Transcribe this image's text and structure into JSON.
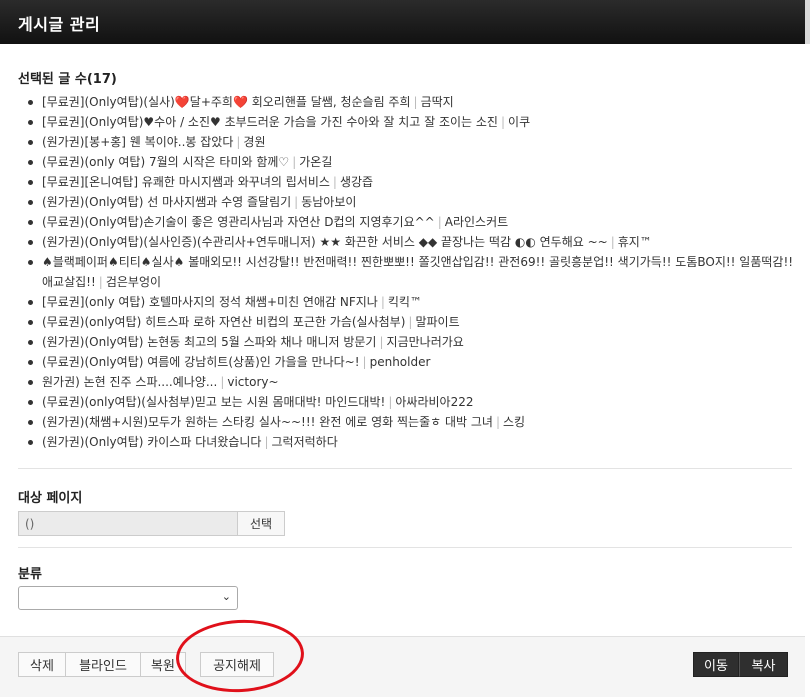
{
  "dialog": {
    "title": "게시글 관리"
  },
  "selected": {
    "heading": "선택된 글 수(17)",
    "posts": [
      {
        "title": "[무료권](Only여탑)(실사)❤️달+주희❤️ 회오리핸플 달쌤, 청순슬림 주희",
        "author": "금딱지"
      },
      {
        "title": "[무료권](Only여탑)♥수아 / 소진♥ 초부드러운 가슴을 가진 수아와 잘 치고 잘 조이는 소진",
        "author": "이쿠"
      },
      {
        "title": "(원가권)[봉+홍] 웬 복이야..봉 잡았다",
        "author": "경원"
      },
      {
        "title": "(무료권)(only 여탑) 7월의 시작은 타미와 함께♡",
        "author": "가온길"
      },
      {
        "title": "[무료권][온니여탑] 유쾌한 마시지쌤과 와꾸녀의 립서비스",
        "author": "생강즙"
      },
      {
        "title": "(원가권)(Only여탑) 선 마사지쌤과 수영 즐달림기",
        "author": "동남아보이"
      },
      {
        "title": "(무료권)(Only여탑)손기술이 좋은 영관리사님과 자연산 D컵의 지영후기요^^",
        "author": "A라인스커트"
      },
      {
        "title": "(원가권)(Only여탑)(실사인증)(수관리사+연두매니저) ★★ 화끈한 서비스 ◆◆ 끝장나는 떡감 ◐◐ 연두해요 ~~",
        "author": "휴지™"
      },
      {
        "title": "♠블랙페이퍼♠티티♠실사♠ 볼매외모!! 시선강탈!! 반전매력!! 찐한뽀뽀!! 쫄깃앤삽입감!! 관전69!! 골릿흥분업!! 색기가득!! 도톰BO지!! 일품떡감!! 애교살집!!",
        "author": "검은부엉이"
      },
      {
        "title": "[무료권](only 여탑) 호텔마사지의 정석 채쌤+미친 연애감 NF지나",
        "author": "킥킥™"
      },
      {
        "title": "(무료권)(only여탑) 히트스파 로하 자연산 비컵의 포근한 가슴(실사첨부)",
        "author": "말파이트"
      },
      {
        "title": "(원가권)(Only여탑) 논현동 최고의 5월 스파와 채나 매니저 방문기",
        "author": "지금만나러가요"
      },
      {
        "title": "(무료권)(Only여탑) 여름에 강남히트(상품)인 가을을 만나다~!",
        "author": "penholder"
      },
      {
        "title": "원가권) 논현 진주 스파....예나양...",
        "author": "victory~"
      },
      {
        "title": "(무료권)(only여탑)(실사첨부)믿고 보는 시원 몸매대박! 마인드대박!",
        "author": "아싸라비아222"
      },
      {
        "title": "(원가권)(채쌤+시원)모두가 원하는 스타킹 실사~~!!! 완전 에로 영화 찍는줄ㅎ 대박 그녀",
        "author": "스킹"
      },
      {
        "title": "(원가권)(Only여탑) 카이스파 다녀왔습니다",
        "author": "그럭저럭하다"
      }
    ]
  },
  "target_page": {
    "label": "대상 페이지",
    "value": "()",
    "select_button": "선택"
  },
  "category": {
    "label": "분류",
    "selected": "",
    "chevron_icon": "chevron-down-icon"
  },
  "footer": {
    "delete_button": "삭제",
    "blind_button": "블라인드",
    "restore_button": "복원",
    "unnotice_button": "공지해제",
    "move_button": "이동",
    "copy_button": "복사"
  },
  "colors": {
    "annotation": "#e0101a",
    "titlebar": "#1a1a1a",
    "dark_button": "#2f2f2f"
  }
}
